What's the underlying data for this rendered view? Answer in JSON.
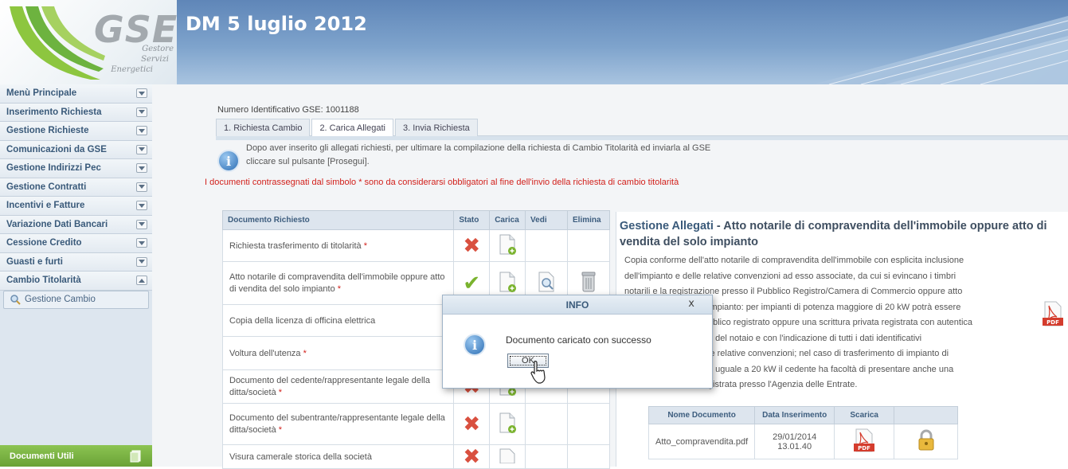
{
  "header": {
    "logo_text": "GSE",
    "logo_sub": [
      "Gestore",
      "Servizi",
      "Energetici"
    ],
    "title": "DM 5 luglio 2012"
  },
  "sidebar": {
    "items": [
      {
        "label": "Menù Principale",
        "icon": "chevron-down-icon"
      },
      {
        "label": "Inserimento Richiesta",
        "icon": "chevron-down-icon"
      },
      {
        "label": "Gestione Richieste",
        "icon": "chevron-down-icon"
      },
      {
        "label": "Comunicazioni da GSE",
        "icon": "chevron-down-icon"
      },
      {
        "label": "Gestione Indirizzi Pec",
        "icon": "chevron-down-icon"
      },
      {
        "label": "Gestione Contratti",
        "icon": "chevron-down-icon"
      },
      {
        "label": "Incentivi e Fatture",
        "icon": "chevron-down-icon"
      },
      {
        "label": "Variazione Dati Bancari",
        "icon": "chevron-down-icon"
      },
      {
        "label": "Cessione Credito",
        "icon": "chevron-down-icon"
      },
      {
        "label": "Guasti e furti",
        "icon": "chevron-down-icon"
      },
      {
        "label": "Cambio Titolarità",
        "icon": "chevron-up-icon"
      }
    ],
    "submenu": {
      "label": "Gestione Cambio",
      "icon": "magnifier-icon"
    },
    "bottom": {
      "label": "Documenti Utili",
      "icon": "documents-icon"
    }
  },
  "main": {
    "id_line": "Numero Identificativo GSE: 1001188",
    "tabs": [
      "1. Richiesta Cambio",
      "2. Carica Allegati",
      "3. Invia Richiesta"
    ],
    "active_tab": 1,
    "info": {
      "line1": "Dopo aver inserito gli allegati richiesti, per ultimare la compilazione della richiesta di Cambio Titolarità ed inviarla al GSE",
      "line2": "cliccare sul pulsante [Prosegui]."
    },
    "warning": "I documenti contrassegnati dal simbolo * sono da considerarsi obbligatori al fine dell'invio della richiesta di cambio titolarità"
  },
  "doc_table": {
    "headers": [
      "Documento Richiesto",
      "Stato",
      "Carica",
      "Vedi",
      "Elimina"
    ],
    "rows": [
      {
        "name": "Richiesta trasferimento di titolarità",
        "required": true,
        "status": "missing"
      },
      {
        "name": "Atto notarile di compravendita dell'immobile oppure atto di vendita del solo impianto",
        "required": true,
        "status": "ok"
      },
      {
        "name": "Copia della licenza di officina elettrica",
        "required": false,
        "status": "hidden"
      },
      {
        "name": "Voltura dell'utenza",
        "required": true,
        "status": "hidden"
      },
      {
        "name": "Documento del cedente/rappresentante legale della ditta/società",
        "required": true,
        "status": "missing"
      },
      {
        "name": "Documento del subentrante/rappresentante legale della ditta/società",
        "required": true,
        "status": "missing"
      },
      {
        "name": "Visura camerale storica della società",
        "required": false,
        "status": "missing"
      }
    ],
    "required_mark": "*"
  },
  "right_panel": {
    "title_prefix": "Gestione Allegati",
    "title_rest": " - Atto notarile di compravendita dell'immobile oppure atto di vendita del solo impianto",
    "body_lines": [
      "Copia conforme dell'atto notarile di compravendita dell'immobile con esplicita inclusione",
      "dell'impianto e delle relative convenzioni ad esso associate, da cui si evincano i timbri",
      "notarili e la registrazione presso il Pubblico Registro/Camera di Commercio oppure atto",
      "impianto: per impianti di potenza maggiore di 20 kW potrà essere",
      "bblico registrato oppure una scrittura privata registrata con autentica",
      "e del notaio e con l'indicazione di tutti i dati identificativi",
      "le relative convenzioni; nel caso di trasferimento di impianto di",
      "o uguale a 20 kW il cedente ha facoltà di presentare anche una",
      "gistrata presso l'Agenzia delle Entrate."
    ],
    "pdf_label": "PDF",
    "download_table": {
      "headers": [
        "Nome Documento",
        "Data Inserimento",
        "Scarica",
        ""
      ],
      "row": {
        "name": "Atto_compravendita.pdf",
        "date": "29/01/2014",
        "time": "13.01.40",
        "pdf_label": "PDF"
      }
    }
  },
  "modal": {
    "title": "INFO",
    "close": "x",
    "message": "Documento caricato con successo",
    "ok_label": "OK"
  },
  "colors": {
    "header_blue": "#6f95c2",
    "sidebar_bg": "#dde6ef",
    "accent_green": "#7ab32e",
    "warning_red": "#d2211c",
    "title_blue": "#3a5a7a"
  }
}
